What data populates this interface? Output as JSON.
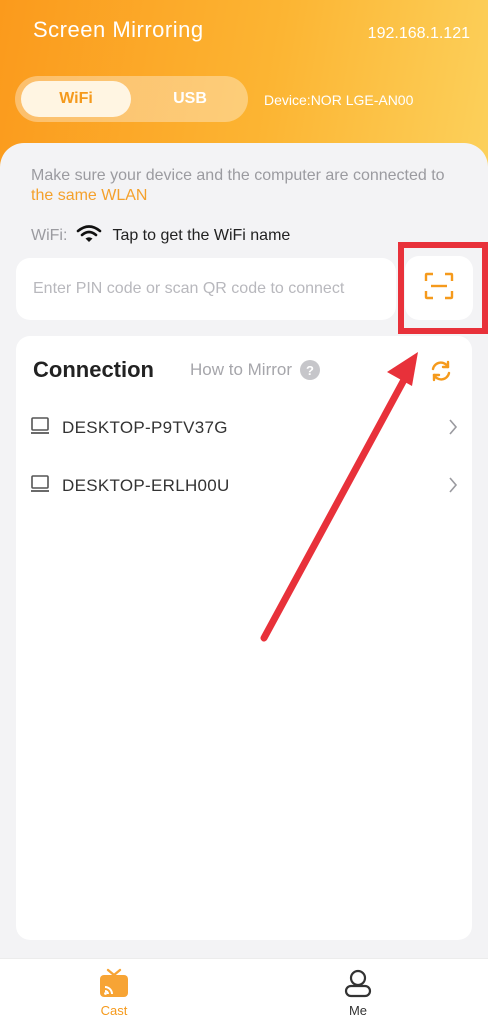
{
  "header": {
    "title": "Screen Mirroring",
    "ip": "192.168.1.121",
    "tabs": [
      {
        "label": "WiFi",
        "active": true
      },
      {
        "label": "USB",
        "active": false
      }
    ],
    "device_label": "Device:",
    "device_name": "NOR  LGE-AN00"
  },
  "hint": {
    "text_before": "Make sure your device and the computer are connected to ",
    "accent": "the same WLAN"
  },
  "wifi": {
    "label": "WiFi:",
    "action": "Tap to get the WiFi name"
  },
  "pin": {
    "placeholder": "Enter PIN code or scan QR code to connect",
    "value": ""
  },
  "connection": {
    "title": "Connection",
    "how_to": "How to Mirror",
    "help_glyph": "?",
    "devices": [
      {
        "name": "DESKTOP-P9TV37G"
      },
      {
        "name": "DESKTOP-ERLH00U"
      }
    ]
  },
  "tabbar": {
    "items": [
      {
        "label": "Cast",
        "active": true
      },
      {
        "label": "Me",
        "active": false
      }
    ]
  },
  "colors": {
    "accent": "#f59a1c",
    "annotation": "#e8313a"
  }
}
